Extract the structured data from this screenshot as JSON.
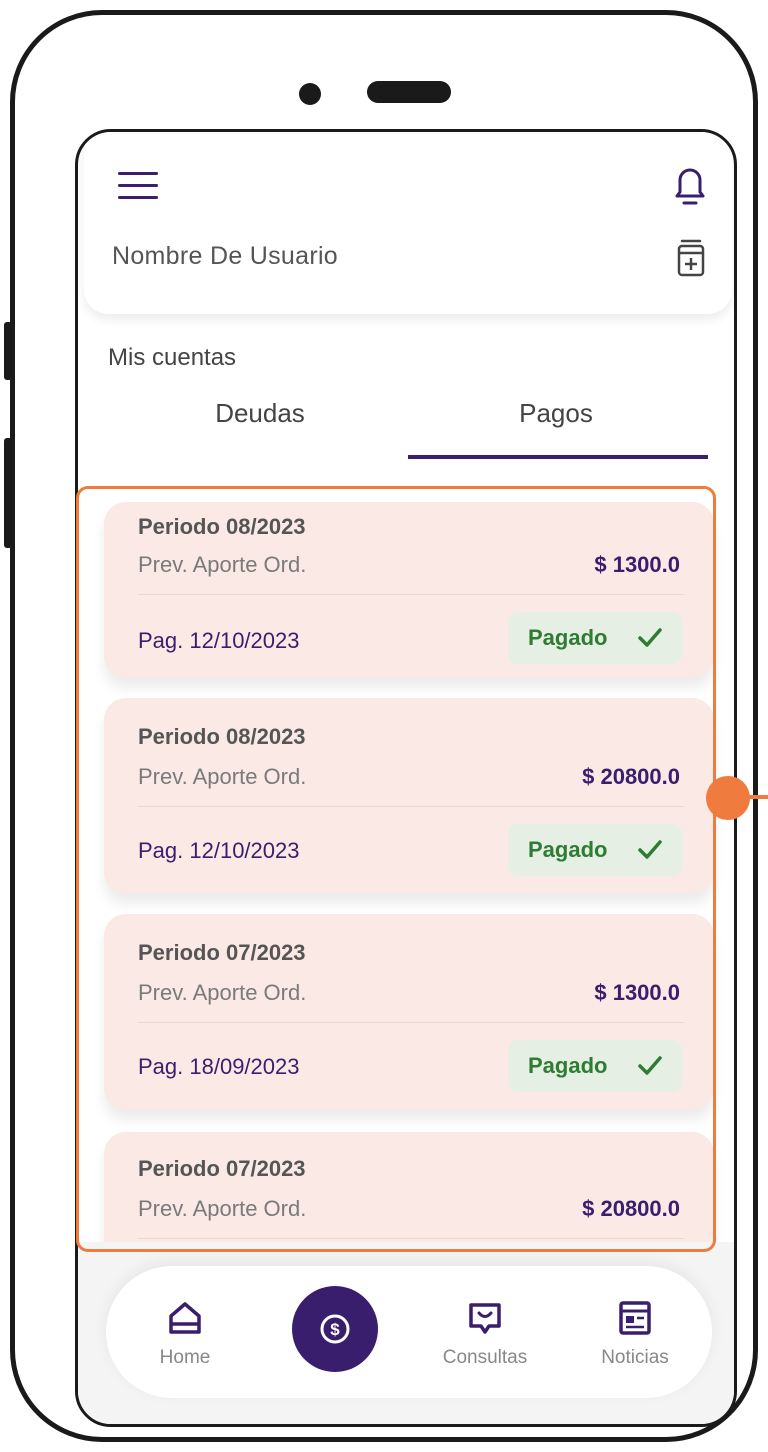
{
  "header": {
    "user_name": "Nombre De Usuario"
  },
  "section_title": "Mis cuentas",
  "tabs": [
    {
      "label": "Deudas",
      "active": false
    },
    {
      "label": "Pagos",
      "active": true
    }
  ],
  "payments": [
    {
      "periodo": "Periodo 08/2023",
      "concepto": "Prev. Aporte Ord.",
      "monto": "$ 1300.0",
      "fecha": "Pag. 12/10/2023",
      "estado": "Pagado"
    },
    {
      "periodo": "Periodo 08/2023",
      "concepto": "Prev. Aporte Ord.",
      "monto": "$ 20800.0",
      "fecha": "Pag. 12/10/2023",
      "estado": "Pagado"
    },
    {
      "periodo": "Periodo 07/2023",
      "concepto": "Prev. Aporte Ord.",
      "monto": "$ 1300.0",
      "fecha": "Pag. 18/09/2023",
      "estado": "Pagado"
    },
    {
      "periodo": "Periodo 07/2023",
      "concepto": "Prev. Aporte Ord.",
      "monto": "$ 20800.0",
      "fecha": "",
      "estado": ""
    }
  ],
  "bottom_nav": {
    "home_label": "Home",
    "consultas_label": "Consultas",
    "noticias_label": "Noticias"
  },
  "icons": {
    "menu": "menu-icon",
    "bell": "bell-icon",
    "calculator": "calculator-icon",
    "home": "home-icon",
    "payment": "dollar-coin-icon",
    "consultas": "chat-icon",
    "noticias": "news-icon",
    "check": "check-icon"
  },
  "colors": {
    "primary": "#3a1e6e",
    "card_bg": "#fbe9e5",
    "paid_badge_bg": "#e6efe3",
    "paid_text": "#2e7d32",
    "annotation": "#ef7b3e"
  }
}
